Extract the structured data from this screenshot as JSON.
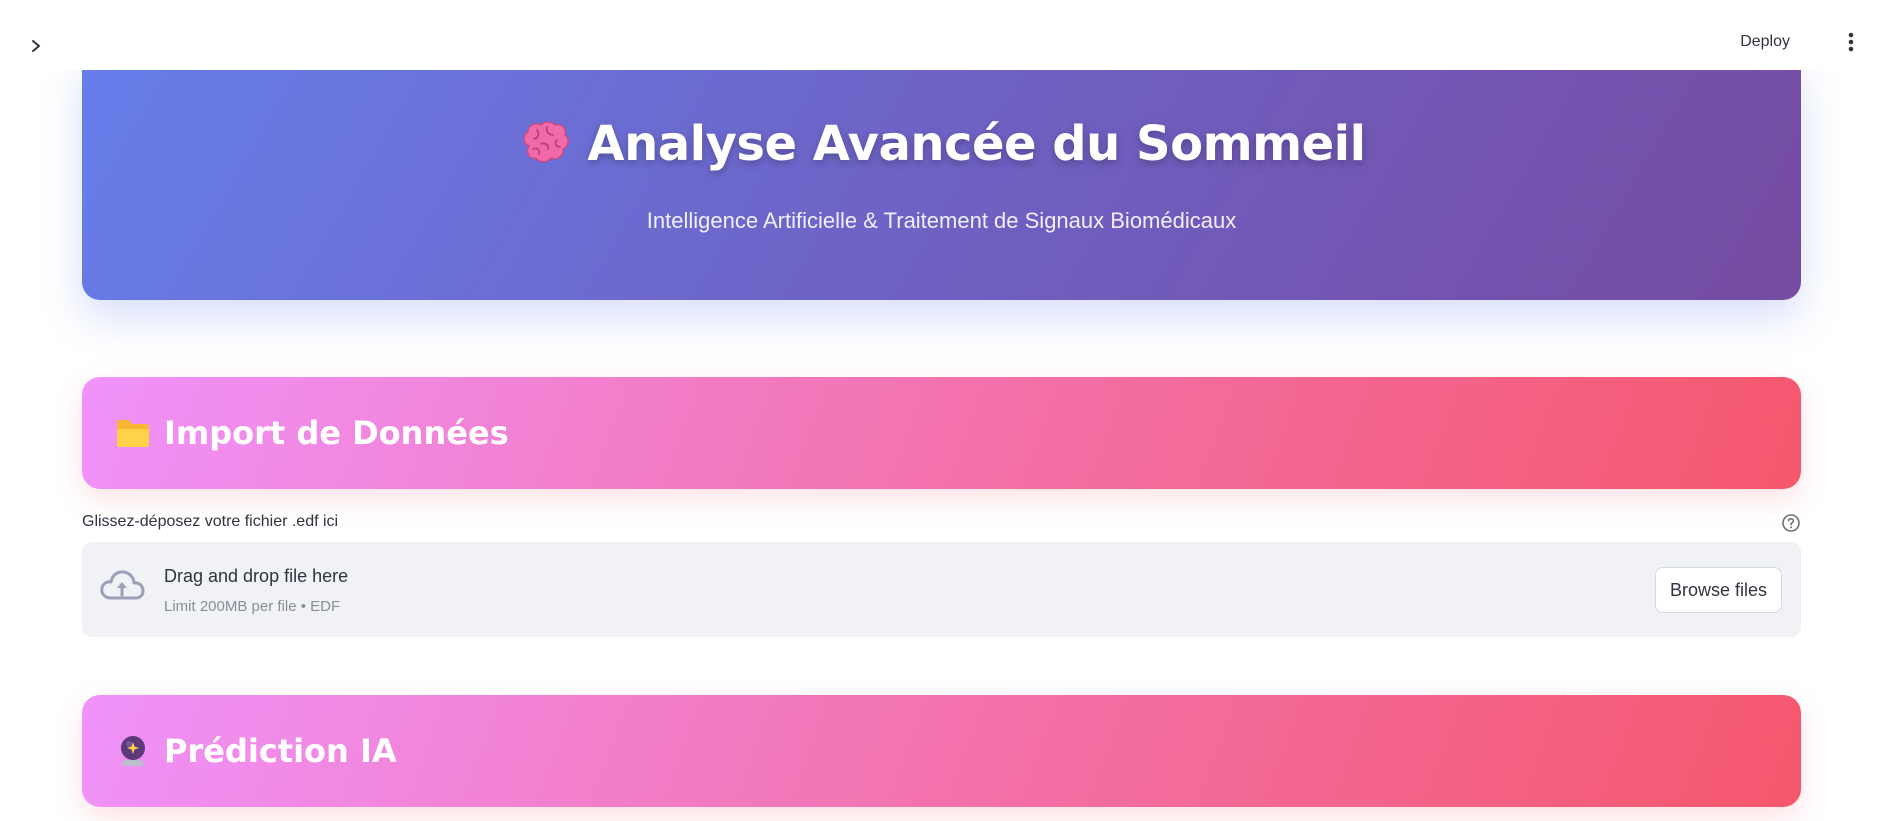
{
  "header": {
    "deploy_label": "Deploy",
    "icons": {
      "sidebar_toggle": "chevron-right-icon",
      "main_menu": "kebab-menu-icon"
    }
  },
  "hero": {
    "emoji": "🧠",
    "title": "Analyse Avancée du Sommeil",
    "subtitle": "Intelligence Artificielle & Traitement de Signaux Biomédicaux",
    "gradient": [
      "#667eea",
      "#764ba2"
    ]
  },
  "sections": {
    "import": {
      "emoji": "📁",
      "title": "Import de Données"
    },
    "predict": {
      "emoji": "🔮",
      "title": "Prédiction IA"
    },
    "gradient": [
      "#f093fb",
      "#f5576c"
    ]
  },
  "uploader": {
    "label": "Glissez-déposez votre fichier .edf ici",
    "drop_text": "Drag and drop file here",
    "limit_text": "Limit 200MB per file • EDF",
    "browse_label": "Browse files",
    "icons": {
      "cloud": "cloud-upload-icon",
      "help": "question-circle-icon"
    }
  }
}
